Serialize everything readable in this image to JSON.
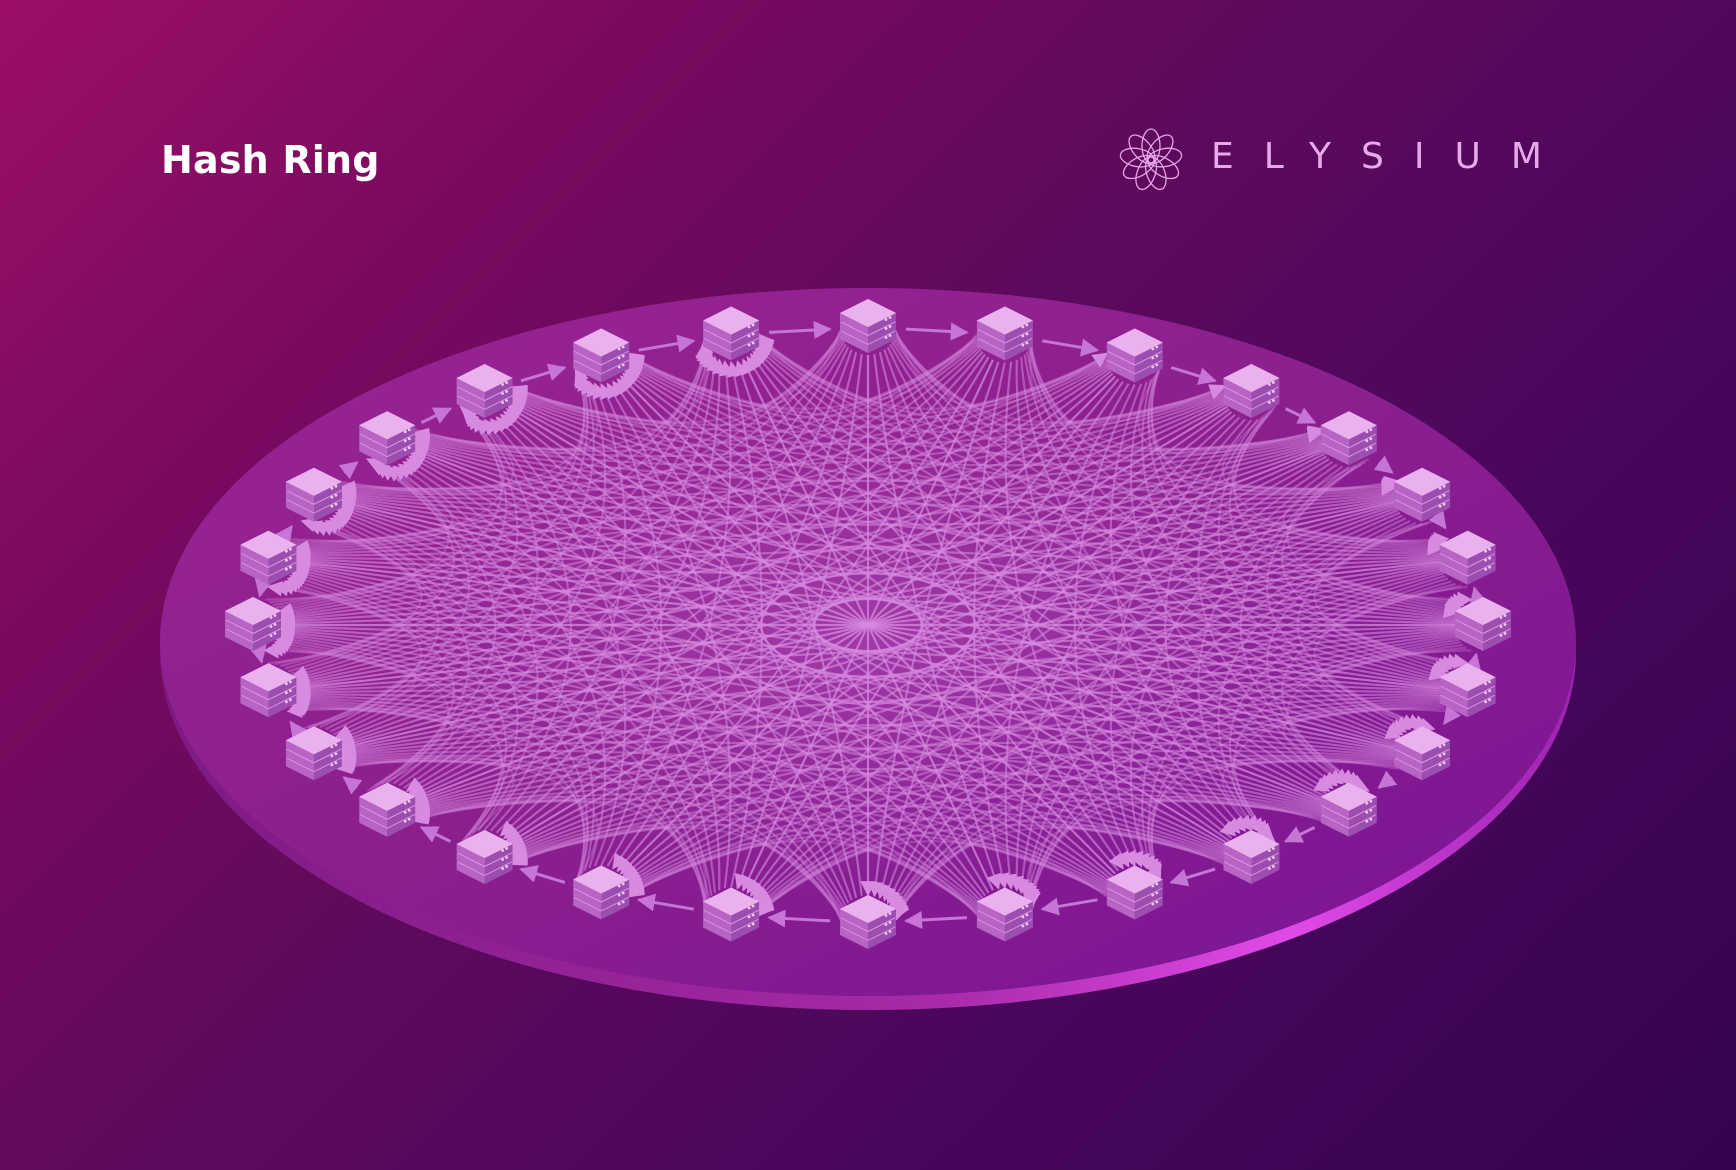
{
  "header": {
    "title": "Hash Ring"
  },
  "brand": {
    "name": "ELYSIUM",
    "icon": "swirl-logo-icon"
  },
  "diagram": {
    "type": "hash-ring",
    "node_count": 28,
    "node_icon": "server-stack-icon",
    "ring_arrow_direction": "clockwise",
    "connections": "every node linked to every other node",
    "colors": {
      "background_start": "#9c0f68",
      "background_end": "#36034f",
      "platform": "#8a1f8e",
      "platform_rim": "#e04ae8",
      "edge": "#d78ae0",
      "node": "#d986dd"
    }
  }
}
